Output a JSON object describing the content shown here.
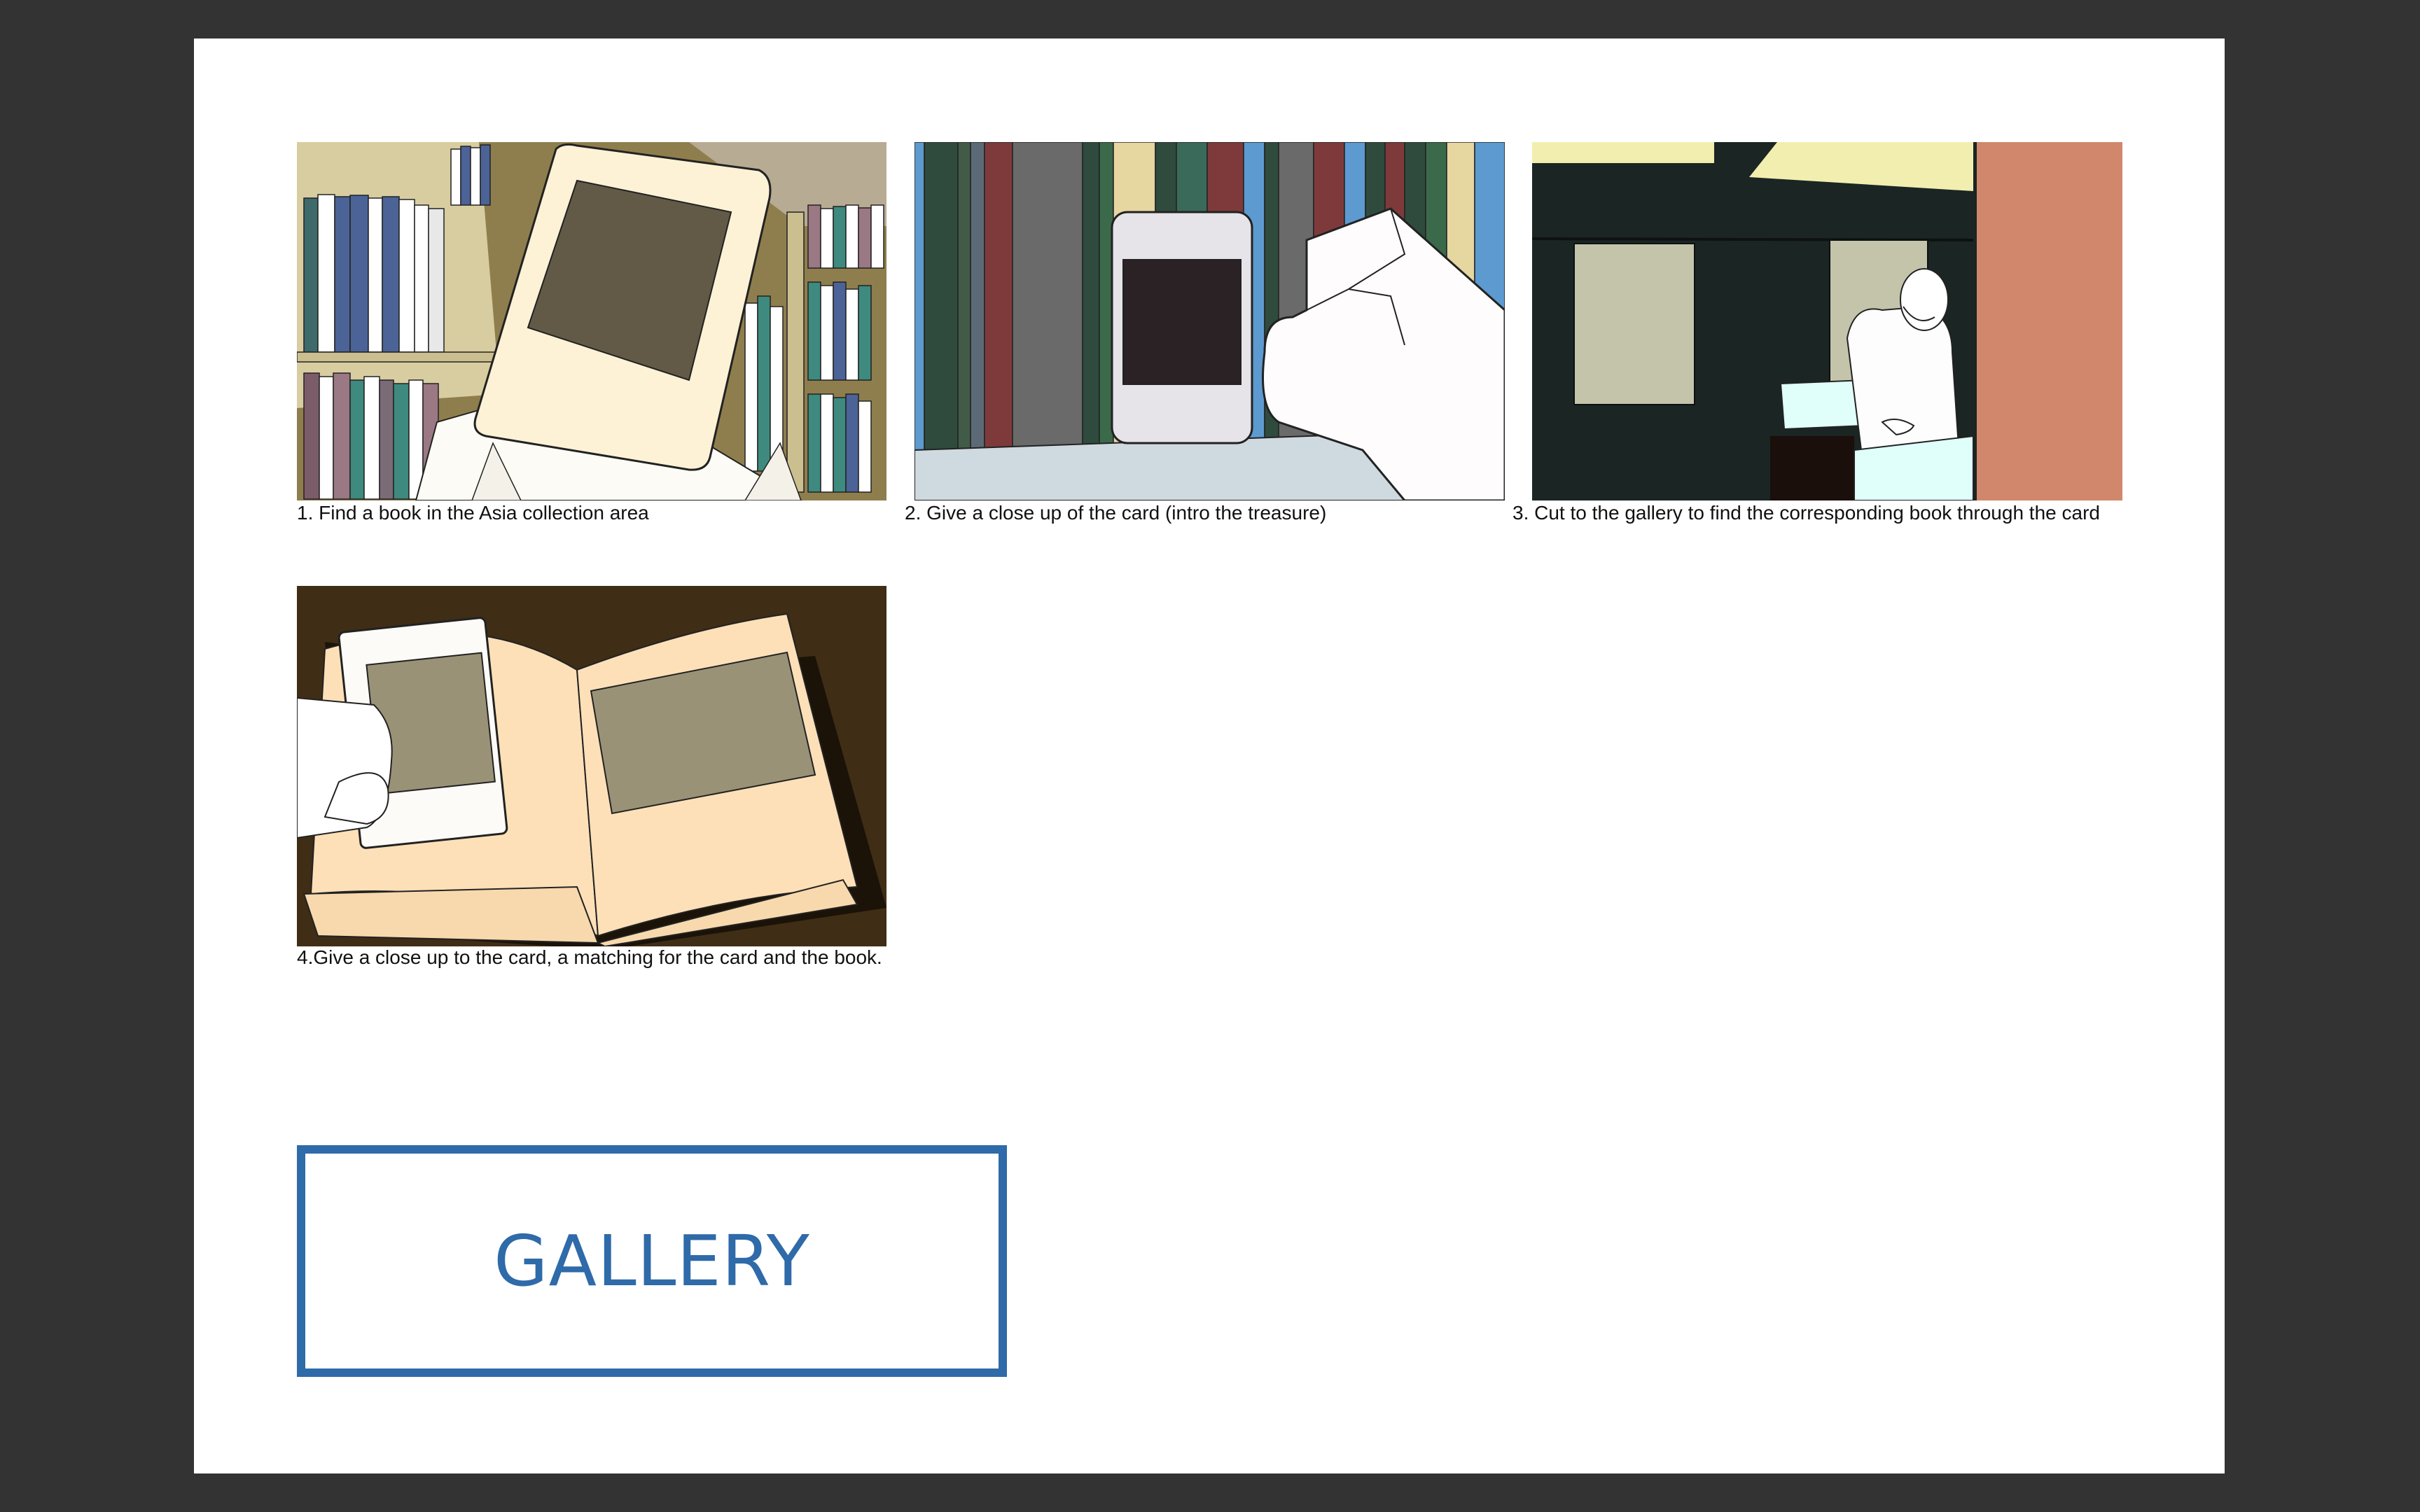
{
  "storyboard": {
    "panels": [
      {
        "caption": "1. Find a book in the Asia collection area",
        "image_icon": "library-shelf-card-illustration"
      },
      {
        "caption": "2. Give a close up of the card (intro the treasure)",
        "image_icon": "hand-holding-card-illustration"
      },
      {
        "caption": "3. Cut to the gallery to find the corresponding book through the card",
        "image_icon": "gallery-visitor-illustration"
      },
      {
        "caption": "4.Give a close up to the card, a matching for the card and the book.",
        "image_icon": "card-matching-book-illustration"
      }
    ]
  },
  "gallery_button": {
    "label": "GALLERY"
  },
  "colors": {
    "backdrop": "#333333",
    "page": "#ffffff",
    "accent": "#2f6aa9"
  }
}
